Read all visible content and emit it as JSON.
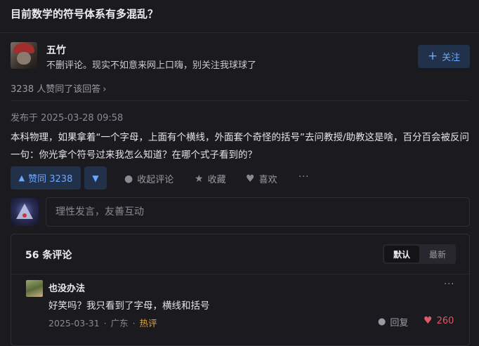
{
  "question": {
    "title": "目前数学的符号体系有多混乱？"
  },
  "author": {
    "name": "五竹",
    "bio": "不删评论。现实不如意来网上口嗨，别关注我球球了",
    "follow_label": "关注",
    "follow_icon": "plus-icon"
  },
  "agree": {
    "text": "3238 人赞同了该回答",
    "chevron": "›"
  },
  "answer": {
    "published": "发布于 2025-03-28 09:58",
    "body": "本科物理，如果拿着“一个字母，上面有个横线，外面套个奇怪的括号”去问教授/助教这是啥，百分百会被反问一句：你光拿个符号过来我怎么知道？在哪个式子看到的？"
  },
  "actions": {
    "vote_label": "赞同 3238",
    "vote_icon": "▲",
    "downvote_icon": "▼",
    "comment_label": "收起评论",
    "favorite_label": "收藏",
    "like_label": "喜欢",
    "more_label": "···"
  },
  "comment_input": {
    "placeholder": "理性发言，友善互动"
  },
  "comments": {
    "count_label": "56 条评论",
    "sort_default": "默认",
    "sort_latest": "最新",
    "items": [
      {
        "name": "也没办法",
        "text": "好笑吗？我只看到了字母，横线和括号",
        "date": "2025-03-31",
        "location": "广东",
        "tag": "热评",
        "reply_label": "回复",
        "likes": "260"
      }
    ]
  },
  "colors": {
    "accent": "#6ea7ff",
    "accent_bg": "#21314a",
    "hot": "#e0a33a",
    "like": "#e0566a"
  }
}
